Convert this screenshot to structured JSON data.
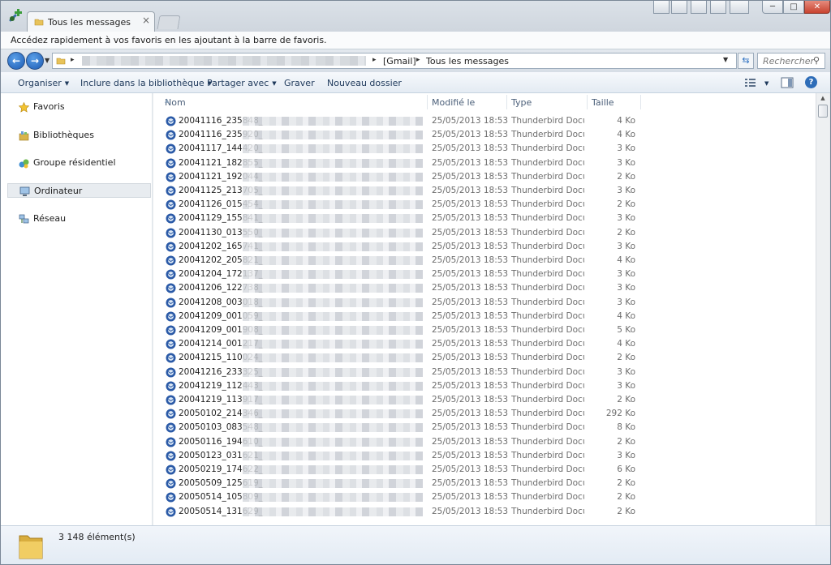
{
  "window": {
    "tab_title": "Tous les messages",
    "tab_close": "×"
  },
  "window_controls": {
    "minimize": "─",
    "maximize": "□",
    "close": "✕"
  },
  "favorites_bar": {
    "message": "Accédez rapidement à vos favoris en les ajoutant à la barre de favoris."
  },
  "address_bar": {
    "crumbs": [
      "[Gmail]",
      "Tous les messages"
    ],
    "separator": "▸",
    "search_placeholder": "Rechercher ..."
  },
  "command_bar": {
    "organize": "Organiser",
    "include_library": "Inclure dans la bibliothèque",
    "share_with": "Partager avec",
    "burn": "Graver",
    "new_folder": "Nouveau dossier"
  },
  "nav_pane": {
    "items": [
      {
        "label": "Favoris",
        "icon": "star-icon"
      },
      {
        "label": "Bibliothèques",
        "icon": "library-icon"
      },
      {
        "label": "Groupe résidentiel",
        "icon": "homegroup-icon"
      },
      {
        "label": "Ordinateur",
        "icon": "computer-icon"
      },
      {
        "label": "Réseau",
        "icon": "network-icon"
      }
    ],
    "selected": "Ordinateur"
  },
  "columns": {
    "name": "Nom",
    "modified": "Modifié le",
    "type": "Type",
    "size": "Taille"
  },
  "files": [
    {
      "name": "20041116_235848_",
      "modified": "25/05/2013 18:53",
      "type": "Thunderbird Docu...",
      "size": "4 Ko"
    },
    {
      "name": "20041116_235920_",
      "modified": "25/05/2013 18:53",
      "type": "Thunderbird Docu...",
      "size": "4 Ko"
    },
    {
      "name": "20041117_144420_",
      "modified": "25/05/2013 18:53",
      "type": "Thunderbird Docu...",
      "size": "3 Ko"
    },
    {
      "name": "20041121_182855_",
      "modified": "25/05/2013 18:53",
      "type": "Thunderbird Docu...",
      "size": "3 Ko"
    },
    {
      "name": "20041121_192044_",
      "modified": "25/05/2013 18:53",
      "type": "Thunderbird Docu...",
      "size": "2 Ko"
    },
    {
      "name": "20041125_213705_",
      "modified": "25/05/2013 18:53",
      "type": "Thunderbird Docu...",
      "size": "3 Ko"
    },
    {
      "name": "20041126_015454_",
      "modified": "25/05/2013 18:53",
      "type": "Thunderbird Docu...",
      "size": "2 Ko"
    },
    {
      "name": "20041129_155841_",
      "modified": "25/05/2013 18:53",
      "type": "Thunderbird Docu...",
      "size": "3 Ko"
    },
    {
      "name": "20041130_013550_",
      "modified": "25/05/2013 18:53",
      "type": "Thunderbird Docu...",
      "size": "2 Ko"
    },
    {
      "name": "20041202_165741_",
      "modified": "25/05/2013 18:53",
      "type": "Thunderbird Docu...",
      "size": "3 Ko"
    },
    {
      "name": "20041202_205821_",
      "modified": "25/05/2013 18:53",
      "type": "Thunderbird Docu...",
      "size": "4 Ko"
    },
    {
      "name": "20041204_172137_",
      "modified": "25/05/2013 18:53",
      "type": "Thunderbird Docu...",
      "size": "3 Ko"
    },
    {
      "name": "20041206_122738_",
      "modified": "25/05/2013 18:53",
      "type": "Thunderbird Docu...",
      "size": "3 Ko"
    },
    {
      "name": "20041208_003018_",
      "modified": "25/05/2013 18:53",
      "type": "Thunderbird Docu...",
      "size": "3 Ko"
    },
    {
      "name": "20041209_001059_",
      "modified": "25/05/2013 18:53",
      "type": "Thunderbird Docu...",
      "size": "4 Ko"
    },
    {
      "name": "20041209_001908_",
      "modified": "25/05/2013 18:53",
      "type": "Thunderbird Docu...",
      "size": "5 Ko"
    },
    {
      "name": "20041214_001217_",
      "modified": "25/05/2013 18:53",
      "type": "Thunderbird Docu...",
      "size": "4 Ko"
    },
    {
      "name": "20041215_110024_",
      "modified": "25/05/2013 18:53",
      "type": "Thunderbird Docu...",
      "size": "2 Ko"
    },
    {
      "name": "20041216_233325_",
      "modified": "25/05/2013 18:53",
      "type": "Thunderbird Docu...",
      "size": "3 Ko"
    },
    {
      "name": "20041219_112443_",
      "modified": "25/05/2013 18:53",
      "type": "Thunderbird Docu...",
      "size": "3 Ko"
    },
    {
      "name": "20041219_113917_",
      "modified": "25/05/2013 18:53",
      "type": "Thunderbird Docu...",
      "size": "2 Ko"
    },
    {
      "name": "20050102_214346_",
      "modified": "25/05/2013 18:53",
      "type": "Thunderbird Docu...",
      "size": "292 Ko"
    },
    {
      "name": "20050103_083548_",
      "modified": "25/05/2013 18:53",
      "type": "Thunderbird Docu...",
      "size": "8 Ko"
    },
    {
      "name": "20050116_194610_",
      "modified": "25/05/2013 18:53",
      "type": "Thunderbird Docu...",
      "size": "2 Ko"
    },
    {
      "name": "20050123_031621_",
      "modified": "25/05/2013 18:53",
      "type": "Thunderbird Docu...",
      "size": "3 Ko"
    },
    {
      "name": "20050219_174622_",
      "modified": "25/05/2013 18:53",
      "type": "Thunderbird Docu...",
      "size": "6 Ko"
    },
    {
      "name": "20050509_125619_",
      "modified": "25/05/2013 18:53",
      "type": "Thunderbird Docu...",
      "size": "2 Ko"
    },
    {
      "name": "20050514_105809_",
      "modified": "25/05/2013 18:53",
      "type": "Thunderbird Docu...",
      "size": "2 Ko"
    },
    {
      "name": "20050514_131629_",
      "modified": "25/05/2013 18:53",
      "type": "Thunderbird Docu...",
      "size": "2 Ko"
    }
  ],
  "details": {
    "item_count": "3 148 élément(s)"
  },
  "colors": {
    "accent": "#2e6db8",
    "nav_selected": "#e8ecf0",
    "secondary_text": "#6d6d6d"
  }
}
